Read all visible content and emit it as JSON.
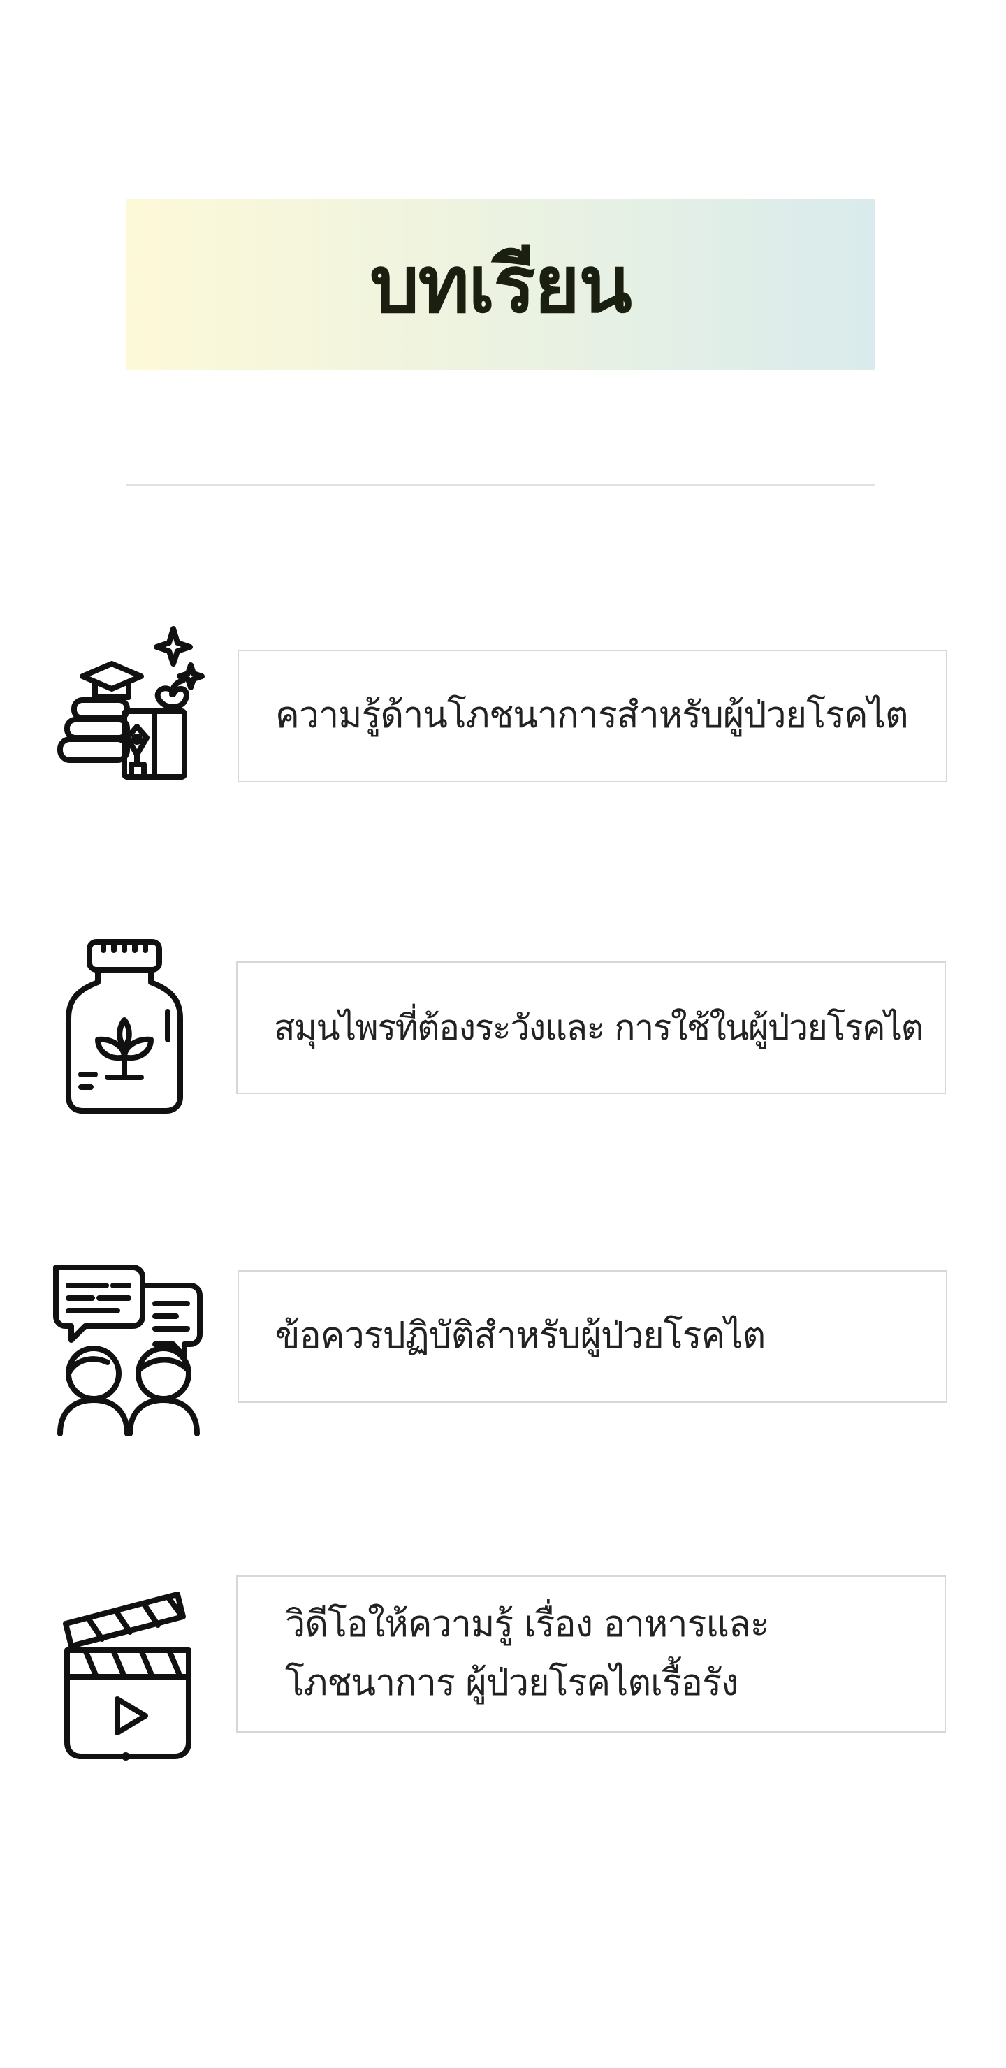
{
  "page": {
    "title": "บทเรียน"
  },
  "lessons": [
    {
      "label": "ความรู้ด้านโภชนาการสำหรับผู้ป่วยโรคไต",
      "icon": "education-books-icon"
    },
    {
      "label": "สมุนไพรที่ต้องระวังและ การใช้ในผู้ป่วยโรคไต",
      "icon": "herbal-medicine-bottle-icon"
    },
    {
      "label": "ข้อควรปฏิบัติสำหรับผู้ป่วยโรคไต",
      "icon": "people-conversation-icon"
    },
    {
      "label": "วิดีโอให้ความรู้ เรื่อง อาหารและโภชนาการ ผู้ป่วยโรคไตเรื้อรัง",
      "icon": "video-clapperboard-icon"
    }
  ],
  "colors": {
    "banner_gradient_start": "#fdf9d8",
    "banner_gradient_end": "#d9ebec",
    "title_color": "#1a1f10",
    "card_border": "#d7d7d7"
  }
}
